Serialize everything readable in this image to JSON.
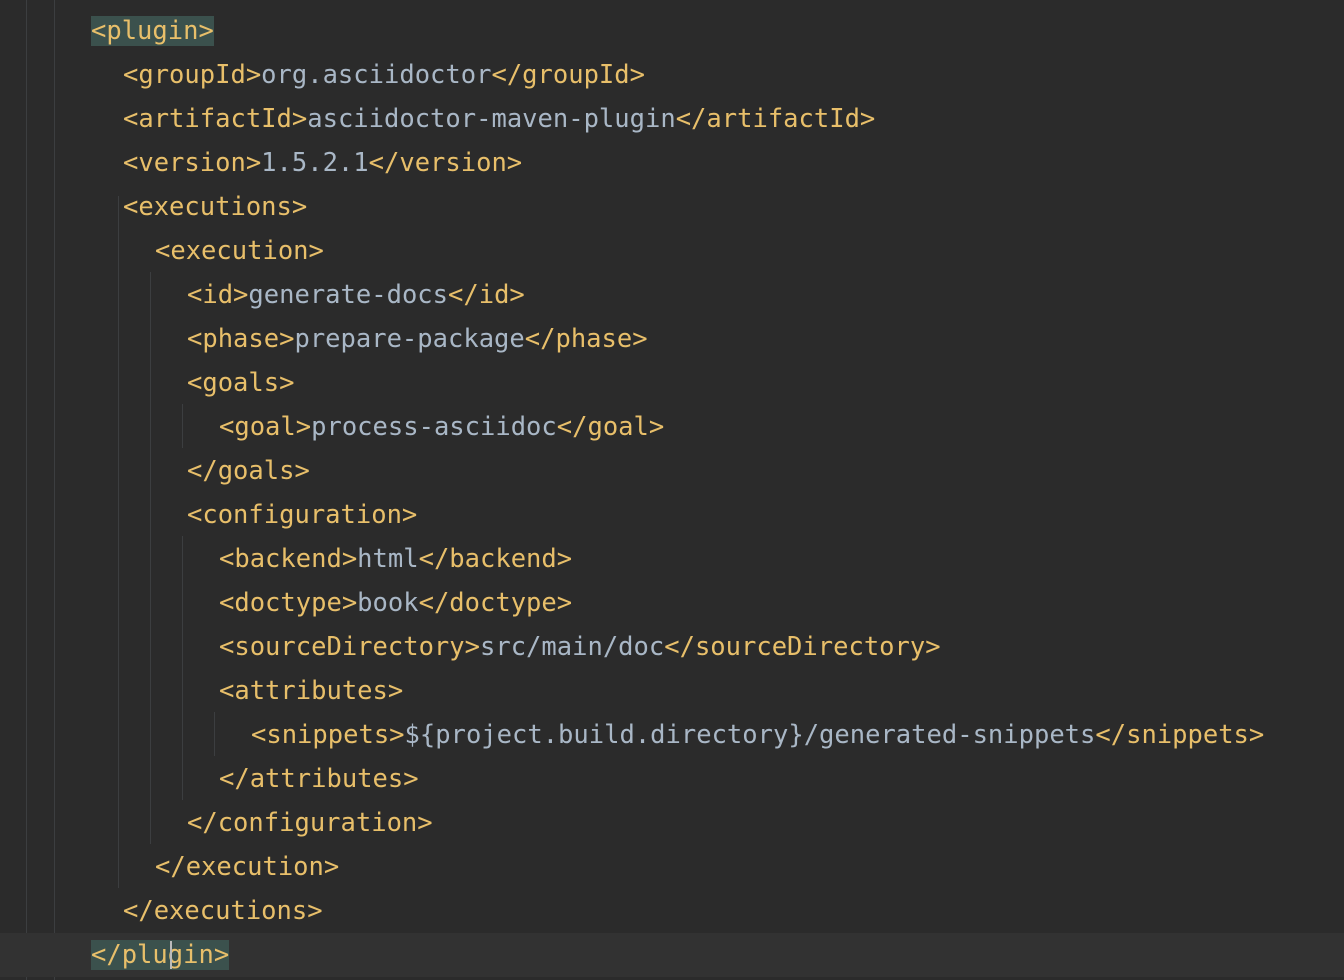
{
  "editor": {
    "language": "XML",
    "lines": [
      {
        "indent": 0,
        "open": "<plugin>",
        "text": "",
        "close": "",
        "matched": true,
        "current": false
      },
      {
        "indent": 1,
        "open": "<groupId>",
        "text": "org.asciidoctor",
        "close": "</groupId>"
      },
      {
        "indent": 1,
        "open": "<artifactId>",
        "text": "asciidoctor-maven-plugin",
        "close": "</artifactId>"
      },
      {
        "indent": 1,
        "open": "<version>",
        "text": "1.5.2.1",
        "close": "</version>"
      },
      {
        "indent": 1,
        "open": "<executions>",
        "text": "",
        "close": ""
      },
      {
        "indent": 2,
        "open": "<execution>",
        "text": "",
        "close": ""
      },
      {
        "indent": 3,
        "open": "<id>",
        "text": "generate-docs",
        "close": "</id>"
      },
      {
        "indent": 3,
        "open": "<phase>",
        "text": "prepare-package",
        "close": "</phase>"
      },
      {
        "indent": 3,
        "open": "<goals>",
        "text": "",
        "close": ""
      },
      {
        "indent": 4,
        "open": "<goal>",
        "text": "process-asciidoc",
        "close": "</goal>"
      },
      {
        "indent": 3,
        "open": "</goals>",
        "text": "",
        "close": ""
      },
      {
        "indent": 3,
        "open": "<configuration>",
        "text": "",
        "close": ""
      },
      {
        "indent": 4,
        "open": "<backend>",
        "text": "html",
        "close": "</backend>"
      },
      {
        "indent": 4,
        "open": "<doctype>",
        "text": "book",
        "close": "</doctype>"
      },
      {
        "indent": 4,
        "open": "<sourceDirectory>",
        "text": "src/main/doc",
        "close": "</sourceDirectory>"
      },
      {
        "indent": 4,
        "open": "<attributes>",
        "text": "",
        "close": ""
      },
      {
        "indent": 5,
        "open": "<snippets>",
        "text": "${project.build.directory}/generated-snippets",
        "close": "</snippets>"
      },
      {
        "indent": 4,
        "open": "</attributes>",
        "text": "",
        "close": ""
      },
      {
        "indent": 3,
        "open": "</configuration>",
        "text": "",
        "close": ""
      },
      {
        "indent": 2,
        "open": "</execution>",
        "text": "",
        "close": ""
      },
      {
        "indent": 1,
        "open": "</executions>",
        "text": "",
        "close": ""
      },
      {
        "indent": 0,
        "open": "</plugin>",
        "text": "",
        "close": "",
        "matched": true,
        "current": true,
        "caret_col": 5
      }
    ]
  },
  "colors": {
    "background": "#2b2b2b",
    "current_line": "#323232",
    "tag": "#e8bf6a",
    "text": "#a9b7c6",
    "brace_match": "#3b514d",
    "indent_guide": "#3c3e40",
    "caret": "#bbbbbb"
  }
}
